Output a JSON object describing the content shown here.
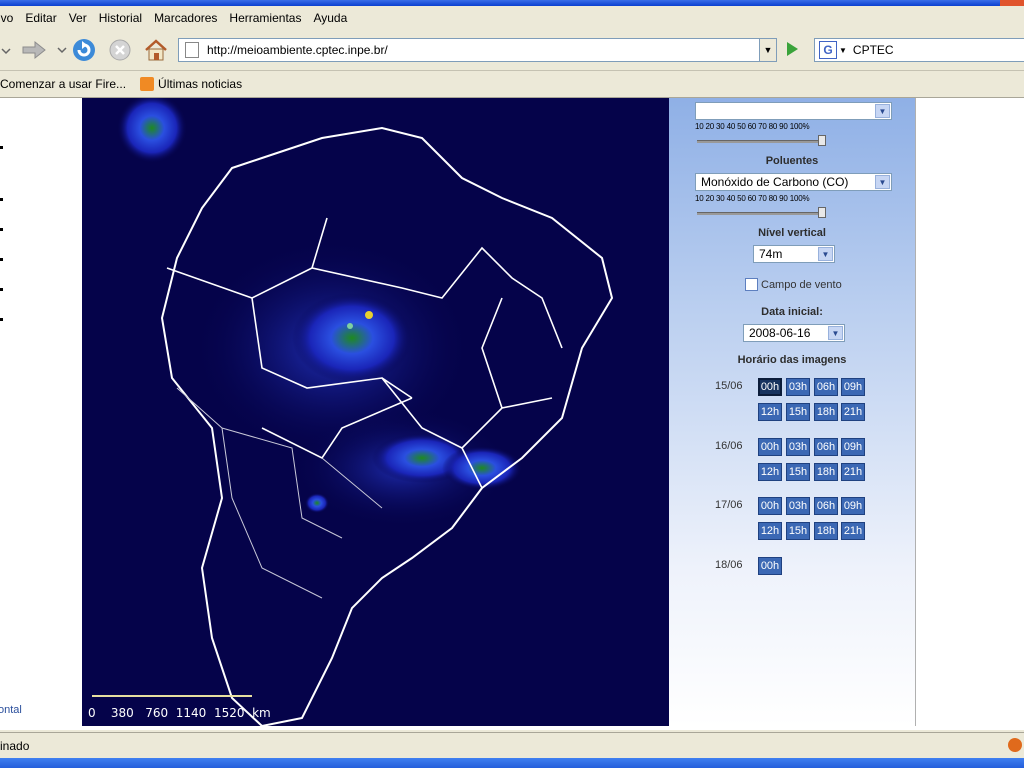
{
  "menu": {
    "items": [
      "ivo",
      "Editar",
      "Ver",
      "Historial",
      "Marcadores",
      "Herramientas",
      "Ayuda"
    ]
  },
  "nav": {
    "url": "http://meioambiente.cptec.inpe.br/",
    "search_value": "CPTEC",
    "search_engine_letter": "G"
  },
  "bookmarks": {
    "item1": "Comenzar a usar Fire...",
    "item2": "Últimas noticias"
  },
  "left": {
    "link": "ontal"
  },
  "map": {
    "scale_label": "0    380   760  1140  1520  km"
  },
  "panel": {
    "top_select_value": "",
    "scale_text": "10 20 30 40 50 60 70 80 90 100%",
    "opacity_top": 0.98,
    "opacity_bottom": 0.98,
    "pollutants_title": "Poluentes",
    "pollutant_value": "Monóxido de Carbono (CO)",
    "vertical_title": "Nível vertical",
    "vertical_value": "74m",
    "wind_label": "Campo de vento",
    "date_title": "Data inicial:",
    "date_value": "2008-06-16",
    "hours_title": "Horário das imagens",
    "days": [
      {
        "label": "15/06",
        "hours": [
          "00h",
          "03h",
          "06h",
          "09h",
          "12h",
          "15h",
          "18h",
          "21h"
        ]
      },
      {
        "label": "16/06",
        "hours": [
          "00h",
          "03h",
          "06h",
          "09h",
          "12h",
          "15h",
          "18h",
          "21h"
        ]
      },
      {
        "label": "17/06",
        "hours": [
          "00h",
          "03h",
          "06h",
          "09h",
          "12h",
          "15h",
          "18h",
          "21h"
        ]
      },
      {
        "label": "18/06",
        "hours": [
          "00h"
        ]
      }
    ]
  },
  "status": {
    "text": "inado"
  }
}
